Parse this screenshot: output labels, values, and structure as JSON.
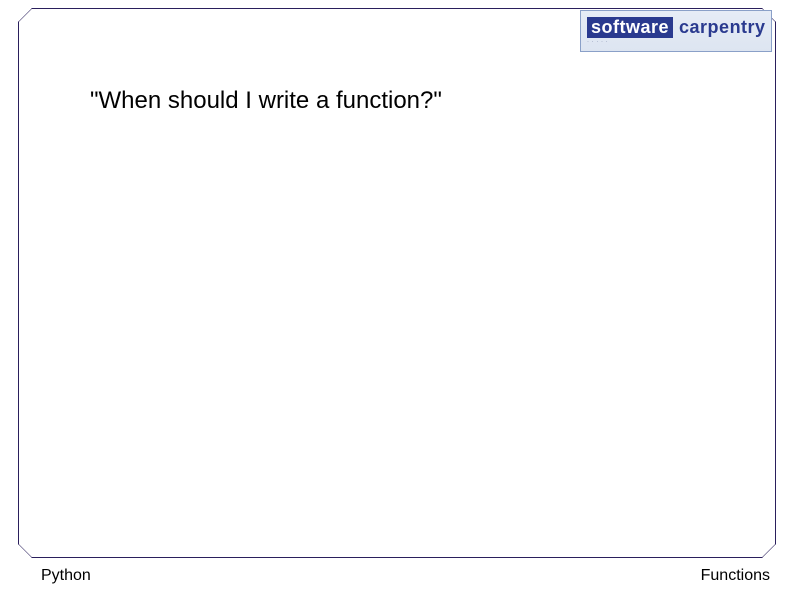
{
  "logo": {
    "word1": "software",
    "word2": "carpentry",
    "tagline": "· · · · ·"
  },
  "headline": "\"When should I write a function?\"",
  "footer": {
    "left": "Python",
    "right": "Functions"
  }
}
